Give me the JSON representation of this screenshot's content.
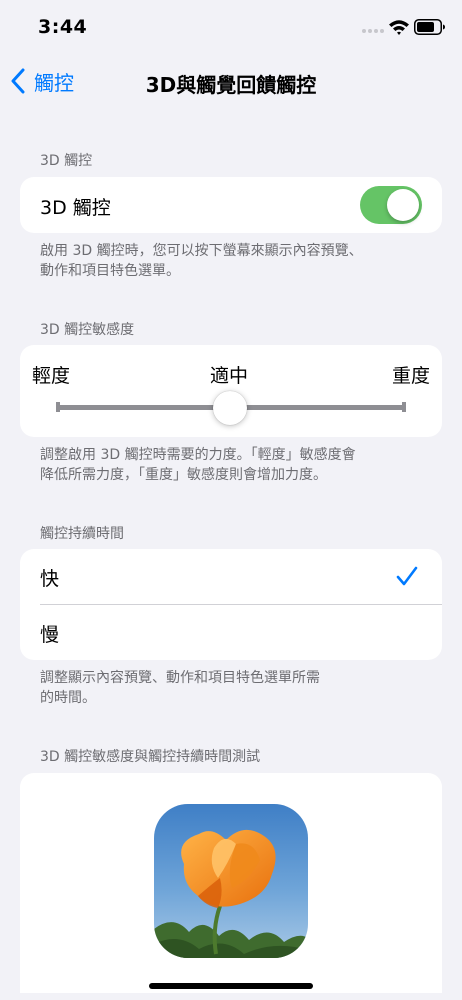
{
  "status_bar": {
    "time": "3:44"
  },
  "nav": {
    "back_label": "觸控",
    "title": "3D與觸覺回饋觸控"
  },
  "section_3d": {
    "header": "3D 觸控",
    "toggle_label": "3D 觸控",
    "toggle_on": true,
    "footer_line1": "啟用 3D 觸控時，您可以按下螢幕來顯示內容預覽、",
    "footer_line2": "動作和項目特色選單。"
  },
  "section_sensitivity": {
    "header": "3D 觸控敏感度",
    "label_light": "輕度",
    "label_medium": "適中",
    "label_firm": "重度",
    "value": 0.5,
    "footer_line1": "調整啟用 3D 觸控時需要的力度。「輕度」敏感度會",
    "footer_line2": "降低所需力度，「重度」敏感度則會增加力度。"
  },
  "section_duration": {
    "header": "觸控持續時間",
    "options": [
      {
        "label": "快",
        "selected": true
      },
      {
        "label": "慢",
        "selected": false
      }
    ],
    "footer_line1": "調整顯示內容預覽、動作和項目特色選單所需",
    "footer_line2": "的時間。"
  },
  "section_test": {
    "header": "3D 觸控敏感度與觸控持續時間測試"
  },
  "colors": {
    "accent": "#007aff",
    "toggle_on": "#65c466",
    "background": "#f2f2f7"
  },
  "icons": {
    "back": "chevron-left-icon",
    "check": "checkmark-icon",
    "wifi": "wifi-icon",
    "battery": "battery-icon"
  }
}
